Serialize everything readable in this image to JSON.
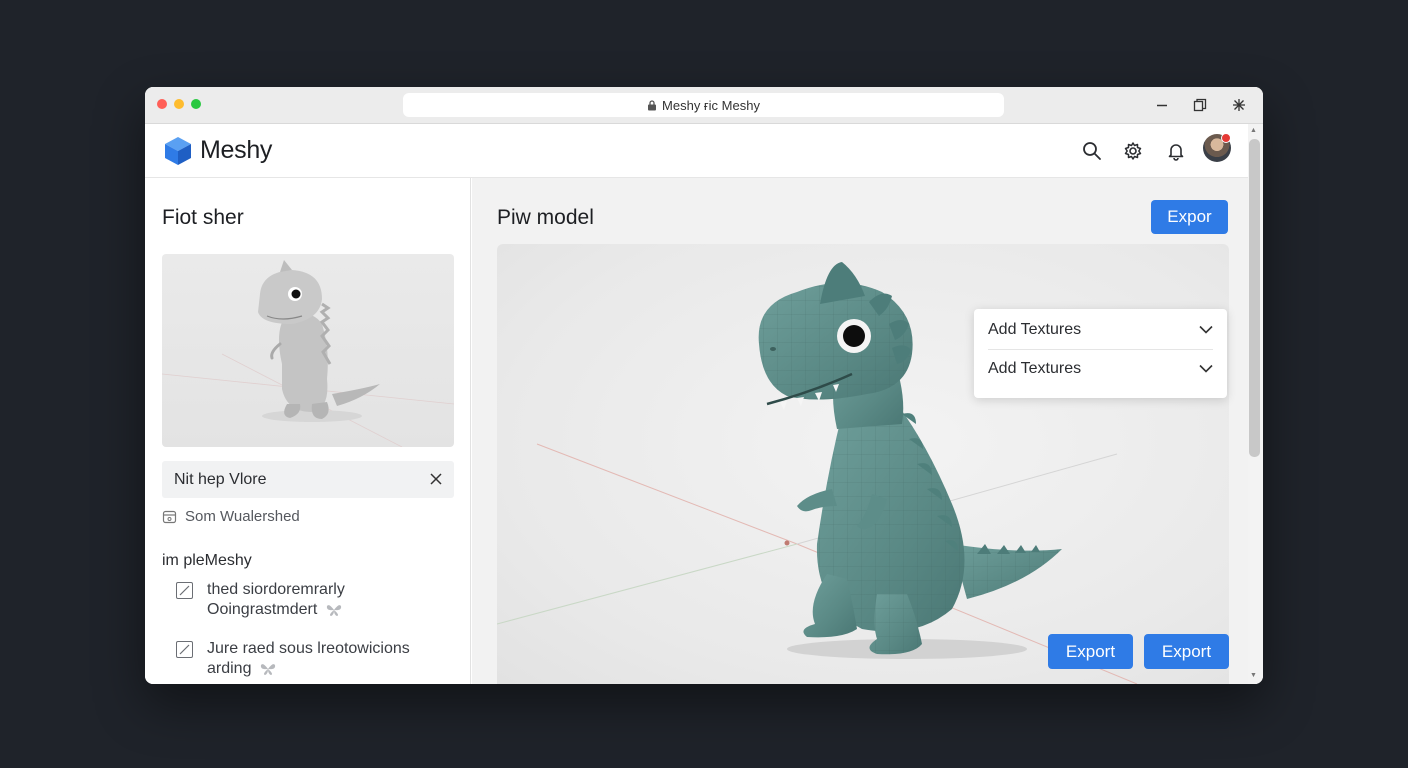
{
  "browser": {
    "url_text": "Meshy ғic Meshy"
  },
  "app": {
    "brand": "Meshy",
    "colors": {
      "accent": "#2f7be6",
      "logo": "#2f7be6",
      "model": "#5e8f8c"
    }
  },
  "left_panel": {
    "title": "Fiot sher",
    "prompt_text": "Nit hep Vlore",
    "meta_text": "Som Wualershed",
    "section_title": "im pleMeshy",
    "items": [
      {
        "line1": "thed siordoremrarly",
        "line2": "Ooingrastmdert"
      },
      {
        "line1": "Jure raed sous lreotowicions",
        "line2": "arding"
      }
    ]
  },
  "right_panel": {
    "title": "Piw model",
    "export_top": "Expor",
    "dropdowns": [
      {
        "label": "Add Textures"
      },
      {
        "label": "Add Textures"
      }
    ],
    "export_buttons": [
      "Export",
      "Export"
    ]
  }
}
